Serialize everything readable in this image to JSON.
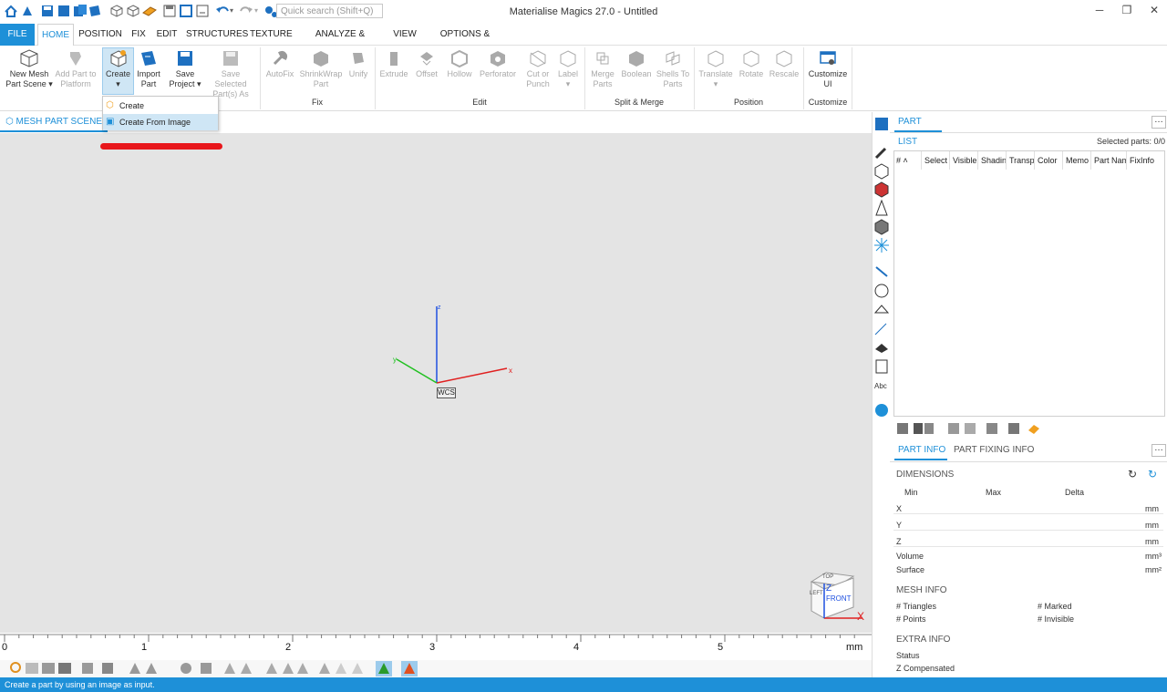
{
  "app": {
    "title": "Materialise Magics 27.0 - Untitled"
  },
  "quick": {
    "search_placeholder": "Quick search (Shift+Q)"
  },
  "icons": {
    "quick_access": [
      "home-icon",
      "import-icon",
      "save-icon",
      "save-all-icon",
      "cube-icon",
      "cube-icon",
      "platform-icon",
      "save-project-icon",
      "save-icon",
      "save-all-icon",
      "undo-icon",
      "redo-icon",
      "settings-icon"
    ],
    "win": [
      "minimize-icon",
      "restore-icon",
      "close-icon"
    ]
  },
  "menu": {
    "tabs": [
      "FILE",
      "HOME",
      "POSITION",
      "FIX",
      "EDIT",
      "STRUCTURES",
      "TEXTURE",
      "ANALYZE & REPORT",
      "VIEW",
      "OPTIONS & HELP"
    ]
  },
  "ribbon": {
    "new_mesh": [
      "New Mesh",
      "Part Scene"
    ],
    "add_part": [
      "Add Part to",
      "Platform"
    ],
    "create": [
      "Create"
    ],
    "import_part": [
      "Import",
      "Part"
    ],
    "save_project": [
      "Save",
      "Project"
    ],
    "save_selected": [
      "Save Selected",
      "Part(s) As"
    ],
    "autofix": [
      "AutoFix"
    ],
    "shrinkwrap": [
      "ShrinkWrap",
      "Part"
    ],
    "unify": [
      "Unify"
    ],
    "extrude": [
      "Extrude"
    ],
    "offset": [
      "Offset"
    ],
    "hollow": [
      "Hollow"
    ],
    "perforator": [
      "Perforator"
    ],
    "cut_punch": [
      "Cut or",
      "Punch"
    ],
    "label": [
      "Label"
    ],
    "merge": [
      "Merge",
      "Parts"
    ],
    "boolean": [
      "Boolean"
    ],
    "shells": [
      "Shells To",
      "Parts"
    ],
    "translate": [
      "Translate"
    ],
    "rotate": [
      "Rotate"
    ],
    "rescale": [
      "Rescale"
    ],
    "customize": [
      "Customize",
      "UI"
    ],
    "groups": {
      "fix": "Fix",
      "edit": "Edit",
      "split": "Split & Merge",
      "position": "Position",
      "customize": "Customize"
    }
  },
  "dropdown": {
    "items": [
      "Create",
      "Create From Image"
    ]
  },
  "scene": {
    "tab": "MESH PART SCENE",
    "wcs": "WCS",
    "axis_x": "x",
    "axis_y": "y",
    "axis_z": "z"
  },
  "viewcube": {
    "top": "TOP",
    "front": "FRONT",
    "left": "LEFT",
    "z": "Z",
    "x": "X"
  },
  "ruler": {
    "labels": [
      "0",
      "1",
      "2",
      "3",
      "4",
      "5"
    ],
    "unit": "mm"
  },
  "status": {
    "text": "Create a part by using an image as input."
  },
  "partlist": {
    "tab": "PART LIST",
    "selected": "Selected parts:  0/0",
    "columns": [
      "#  ˄",
      "Select",
      "Visible",
      "Shading",
      "Transp",
      "Color",
      "Memo",
      "Part Name",
      "FixInfo"
    ]
  },
  "partinfo": {
    "tabs": [
      "PART INFO",
      "PART FIXING INFO"
    ],
    "dimensions": "DIMENSIONS",
    "cols": [
      "Min",
      "Max",
      "Delta"
    ],
    "rows": [
      {
        "label": "X",
        "unit": "mm"
      },
      {
        "label": "Y",
        "unit": "mm"
      },
      {
        "label": "Z",
        "unit": "mm"
      }
    ],
    "volume": {
      "label": "Volume",
      "unit": "mm³"
    },
    "surface": {
      "label": "Surface",
      "unit": "mm²"
    },
    "mesh_info": "MESH INFO",
    "triangles": "# Triangles",
    "marked": "# Marked",
    "points": "# Points",
    "invisible": "# Invisible",
    "extra_info": "EXTRA INFO",
    "status": "Status",
    "z_comp": "Z Compensated"
  },
  "more": "…",
  "colors": {
    "accent": "#1e90d8",
    "viewport": "#e4e4e4",
    "highlight_bar": "#e8161b"
  }
}
